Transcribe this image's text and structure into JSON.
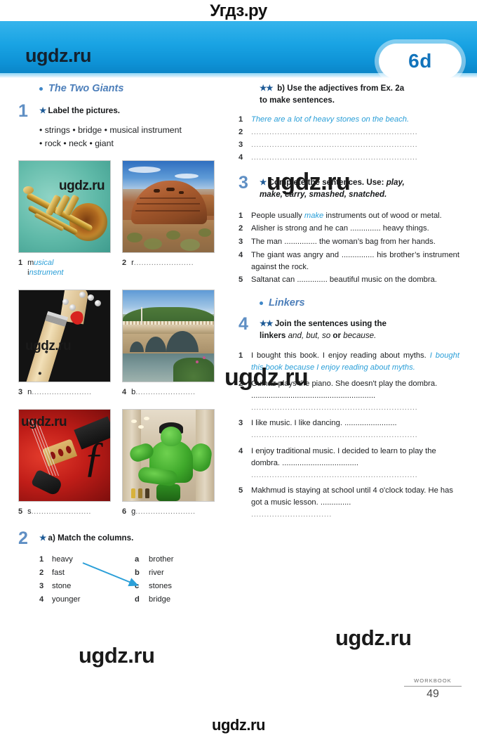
{
  "watermarks": {
    "top": "Угдз.ру",
    "bottom": "ugdz.ru",
    "header": "ugdz.ru",
    "repeat": "ugdz.ru"
  },
  "header": {
    "badge": "6d"
  },
  "left": {
    "section_label": "The Two Giants",
    "ex1": {
      "number": "1",
      "stars": "★",
      "instruction": "Label the pictures.",
      "wordbank_line1": "• strings  • bridge  • musical instrument",
      "wordbank_line2": "• rock  • neck  • giant",
      "pictures": [
        {
          "num": "1",
          "prefix": "m",
          "answer": "usical",
          "answer2_prefix": "i",
          "answer2": "nstrument",
          "dots": "",
          "alt": "trumpet"
        },
        {
          "num": "2",
          "prefix": "r",
          "answer": "",
          "dots": "........................",
          "alt": "red rock"
        },
        {
          "num": "3",
          "prefix": "n",
          "answer": "",
          "dots": "........................",
          "alt": "guitar neck"
        },
        {
          "num": "4",
          "prefix": "b",
          "answer": "",
          "dots": "........................",
          "alt": "stone bridge"
        },
        {
          "num": "5",
          "prefix": "s",
          "answer": "",
          "dots": "........................",
          "alt": "violin strings"
        },
        {
          "num": "6",
          "prefix": "g",
          "answer": "",
          "dots": "........................",
          "alt": "giant hulk statue"
        }
      ]
    },
    "ex2": {
      "number": "2",
      "stars": "★",
      "instruction": "a) Match the columns.",
      "rows": [
        {
          "num": "1",
          "left": "heavy",
          "letter": "a",
          "right": "brother"
        },
        {
          "num": "2",
          "left": "fast",
          "letter": "b",
          "right": "river"
        },
        {
          "num": "3",
          "left": "stone",
          "letter": "c",
          "right": "stones"
        },
        {
          "num": "4",
          "left": "younger",
          "letter": "d",
          "right": "bridge"
        }
      ]
    }
  },
  "right": {
    "ex2b": {
      "stars": "★★",
      "instruction_line1": "b) Use the adjectives from Ex. 2a",
      "instruction_line2": "to make sentences.",
      "items": [
        {
          "num": "1",
          "answer": "There are a lot of heavy stones on the beach.",
          "dots": ""
        },
        {
          "num": "2",
          "answer": "",
          "dots": "................................................................"
        },
        {
          "num": "3",
          "answer": "",
          "dots": "................................................................"
        },
        {
          "num": "4",
          "answer": "",
          "dots": "................................................................"
        }
      ]
    },
    "ex3": {
      "number": "3",
      "stars": "★",
      "instruction_bold": "Complete the sentences. Use:",
      "instruction_italic_1": " play,",
      "instruction_italic_2": "make, carry, smashed, snatched.",
      "items": [
        {
          "num": "1",
          "pre": "People usually ",
          "blank_answer": "make",
          "post": " instruments out of wood or metal."
        },
        {
          "num": "2",
          "pre": "Alisher is strong and he can ",
          "blank_answer": "",
          "blank_dots": "..............",
          "post": " heavy things."
        },
        {
          "num": "3",
          "pre": "The man ",
          "blank_answer": "",
          "blank_dots": "...............",
          "post": " the woman’s bag from her hands."
        },
        {
          "num": "4",
          "pre": "The giant was angry and ",
          "blank_answer": "",
          "blank_dots": "...............",
          "post": " his brother’s instrument against the rock."
        },
        {
          "num": "5",
          "pre": "Saltanat can ",
          "blank_answer": "",
          "blank_dots": "..............",
          "post": " beautiful music on the dombra."
        }
      ]
    },
    "linkers_label": "Linkers",
    "ex4": {
      "number": "4",
      "stars": "★★",
      "instruction_line1": "Join the sentences using the",
      "instruction_bold2": "linkers ",
      "instruction_italic": "and, but, so ",
      "instruction_or": "or ",
      "instruction_italic2": "because.",
      "items": [
        {
          "num": "1",
          "text": "I bought this book. I enjoy reading about myths. ",
          "answer": "I bought this book because I enjoy reading about myths.",
          "dots": ""
        },
        {
          "num": "2",
          "text": "Gulnaz plays the piano. She doesn't play the dombra. ",
          "answer": "",
          "dots": ".........................................................",
          "dots2": "................................................................"
        },
        {
          "num": "3",
          "text": "I like music. I like dancing. ",
          "answer": "",
          "dots": "........................",
          "dots2": "................................................................"
        },
        {
          "num": "4",
          "text": "I enjoy traditional music. I decided to learn to play the dombra. ",
          "answer": "",
          "dots": "...................................",
          "dots2": "................................................................"
        },
        {
          "num": "5",
          "text": "Makhmud is staying at school until 4 o'clock today. He has got a music lesson. ",
          "answer": "",
          "dots": "..............",
          "dots2": "..............................."
        }
      ]
    }
  },
  "footer": {
    "label": "WORKBOOK",
    "page": "49"
  },
  "colors": {
    "accent_blue": "#2b9fd8",
    "header_blue": "#19a3e3",
    "number_blue": "#5f8fc4",
    "badge_text": "#1173bb",
    "star_blue": "#1d5a96"
  }
}
